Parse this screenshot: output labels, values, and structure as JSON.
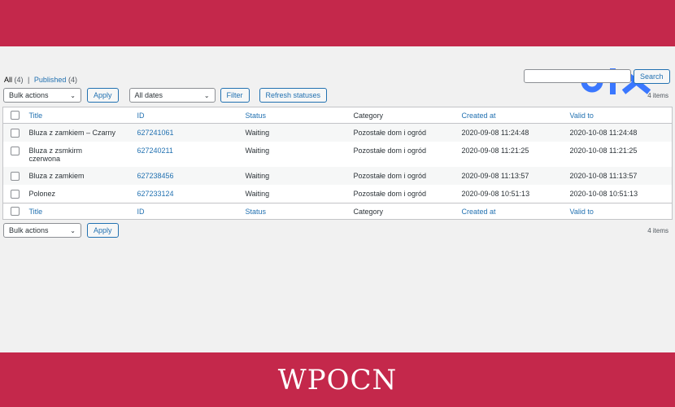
{
  "branding": {
    "footer_text": "WPOCN",
    "logo_text": "olx"
  },
  "colors": {
    "band": "#c4284b",
    "link": "#2271b1",
    "logo": "#3a77ff"
  },
  "views": [
    {
      "label": "All",
      "count": "(4)"
    },
    {
      "separator": "|"
    },
    {
      "label": "Published",
      "count": "(4)"
    }
  ],
  "search": {
    "button_label": "Search",
    "value": ""
  },
  "tablenav_top": {
    "bulk_actions": "Bulk actions",
    "apply": "Apply",
    "dates": "All dates",
    "filter": "Filter",
    "refresh": "Refresh statuses",
    "items": "4 items"
  },
  "tablenav_bottom": {
    "bulk_actions": "Bulk actions",
    "apply": "Apply",
    "items": "4 items"
  },
  "columns": [
    "Title",
    "ID",
    "Status",
    "Category",
    "Created at",
    "Valid to"
  ],
  "rows": [
    {
      "title": "Bluza z zamkiem – Czarny",
      "id": "627241061",
      "status": "Waiting",
      "category": "Pozostałe dom i ogród",
      "created": "2020-09-08 11:24:48",
      "valid": "2020-10-08 11:24:48"
    },
    {
      "title": "Bluza z zsmkirm czerwona",
      "id": "627240211",
      "status": "Waiting",
      "category": "Pozostałe dom i ogród",
      "created": "2020-09-08 11:21:25",
      "valid": "2020-10-08 11:21:25"
    },
    {
      "title": "Bluza z zamkiem",
      "id": "627238456",
      "status": "Waiting",
      "category": "Pozostałe dom i ogród",
      "created": "2020-09-08 11:13:57",
      "valid": "2020-10-08 11:13:57"
    },
    {
      "title": "Polonez",
      "id": "627233124",
      "status": "Waiting",
      "category": "Pozostałe dom i ogród",
      "created": "2020-09-08 10:51:13",
      "valid": "2020-10-08 10:51:13"
    }
  ]
}
